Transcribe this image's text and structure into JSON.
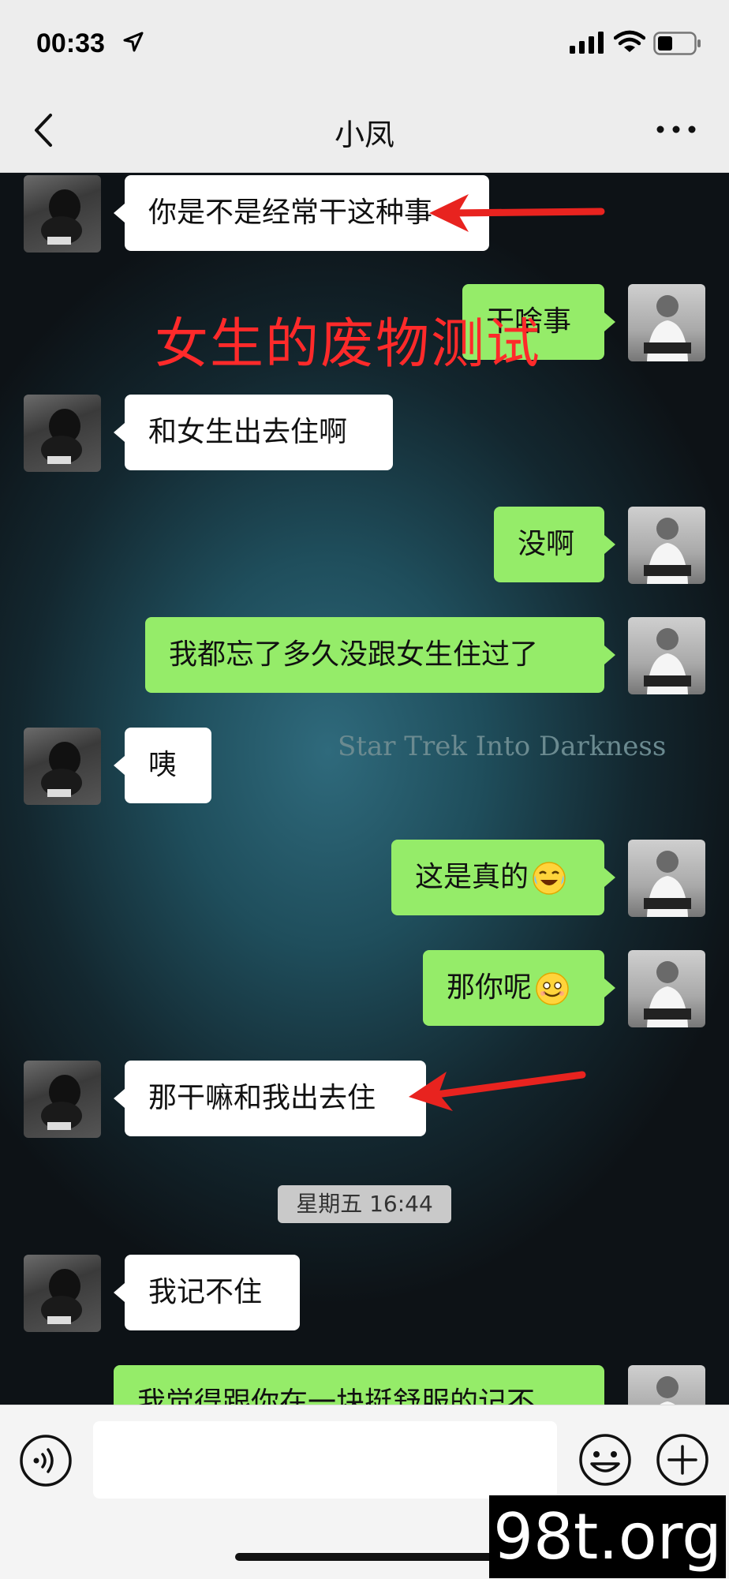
{
  "status_bar": {
    "time": "00:33",
    "location_icon": "location-arrow-icon",
    "signal_icon": "cell-signal-icon",
    "wifi_icon": "wifi-icon",
    "battery_icon": "battery-icon"
  },
  "nav": {
    "title": "小凤",
    "back_icon": "chevron-left-icon",
    "more_icon": "more-dots-icon"
  },
  "messages": [
    {
      "side": "left",
      "text": "你是不是经常干这种事"
    },
    {
      "side": "right",
      "text": "干啥事"
    },
    {
      "side": "left",
      "text": "和女生出去住啊"
    },
    {
      "side": "right",
      "text": "没啊"
    },
    {
      "side": "right",
      "text": "我都忘了多久没跟女生住过了"
    },
    {
      "side": "left",
      "text": "咦"
    },
    {
      "side": "right",
      "text": "这是真的",
      "emoji": "laugh-cry-emoji"
    },
    {
      "side": "right",
      "text": "那你呢",
      "emoji": "grin-sweat-emoji"
    },
    {
      "side": "left",
      "text": "那干嘛和我出去住"
    },
    {
      "side": "left",
      "text": "我记不住"
    },
    {
      "side": "right",
      "text": "我觉得跟你在一块挺舒服的记不"
    }
  ],
  "timestamp": "星期五 16:44",
  "overlay": {
    "caption": "女生的废物测试",
    "watermark": "Star Trek Into Darkness",
    "site": "98t.org",
    "arrow_color": "#e8231f"
  },
  "input_bar": {
    "voice_icon": "voice-input-icon",
    "emoji_icon": "emoji-face-icon",
    "plus_icon": "plus-circle-icon",
    "text_value": ""
  },
  "colors": {
    "bubble_left": "#ffffff",
    "bubble_right": "#95ec69",
    "bar_bg": "#ededed"
  }
}
